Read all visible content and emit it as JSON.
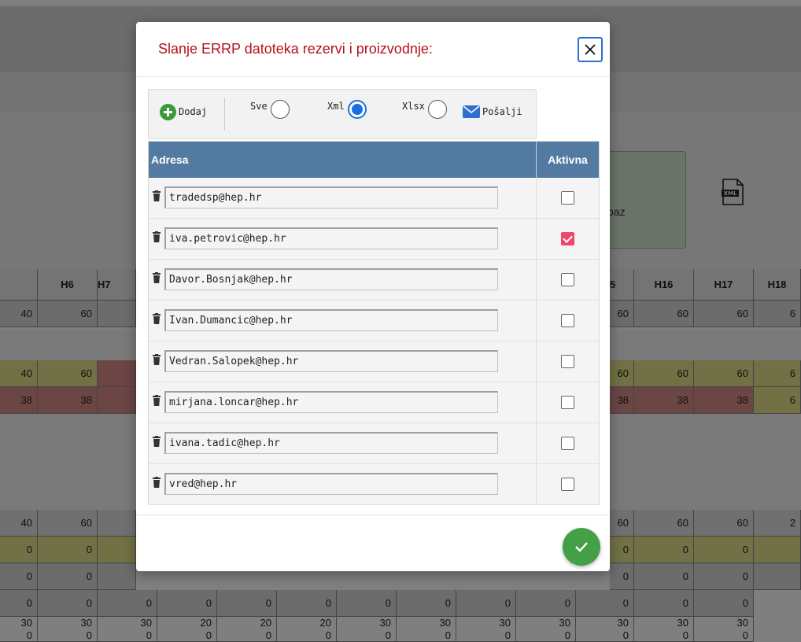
{
  "background": {
    "tile_label": "baz",
    "header_left": [
      "",
      "H6",
      "H7"
    ],
    "header_right": [
      "5",
      "H16",
      "H17",
      "H18"
    ],
    "rows": [
      {
        "color": "#d9d9d9",
        "left": [
          "40",
          "60"
        ],
        "right": [
          "60",
          "60",
          "60",
          "6"
        ]
      },
      {
        "color": "#e3e38a",
        "left": [
          "40",
          "60"
        ],
        "right": [
          "60",
          "60",
          "60",
          "6"
        ],
        "h7": "#d98b8b"
      },
      {
        "color": "#d98b8b",
        "left": [
          "38",
          "38"
        ],
        "right": [
          "38",
          "38",
          "38",
          "6"
        ],
        "right_last_color": "#e3e38a"
      },
      {
        "color": "#e0e0e0",
        "left": [
          "40",
          "60"
        ],
        "right": [
          "60",
          "60",
          "60",
          "2"
        ]
      },
      {
        "color": "#e3e38a",
        "left": [
          "0",
          "0"
        ],
        "right": [
          "0",
          "0",
          "0",
          ""
        ]
      },
      {
        "color": "#d9d9d9",
        "left": [
          "0",
          "0"
        ],
        "right": [
          "0",
          "0",
          "0",
          ""
        ]
      }
    ],
    "bottom_row_0": [
      "0",
      "0",
      "0",
      "0",
      "0",
      "0",
      "0",
      "0",
      "0",
      "0",
      "0",
      "0",
      "0"
    ],
    "bottom_row_30": [
      "30",
      "30",
      "30",
      "20",
      "20",
      "20",
      "30",
      "30",
      "30",
      "30",
      "30",
      "30",
      "30"
    ],
    "bottom_row_0b": [
      "0",
      "0",
      "0",
      "0",
      "0",
      "0",
      "0",
      "0",
      "0",
      "0",
      "0",
      "0",
      "0"
    ]
  },
  "modal": {
    "title": "Slanje ERRP datoteka rezervi i proizvodnje:",
    "toolbar": {
      "add_label": "Dodaj",
      "radios": [
        {
          "label": "Sve",
          "checked": false
        },
        {
          "label": "Xml",
          "checked": true
        },
        {
          "label": "Xlsx",
          "checked": false
        }
      ],
      "send_label": "Pošalji"
    },
    "table": {
      "col_address": "Adresa",
      "col_active": "Aktivna",
      "rows": [
        {
          "email": "tradedsp@hep.hr",
          "active": false
        },
        {
          "email": "iva.petrovic@hep.hr",
          "active": true
        },
        {
          "email": "Davor.Bosnjak@hep.hr",
          "active": false
        },
        {
          "email": "Ivan.Dumancic@hep.hr",
          "active": false
        },
        {
          "email": "Vedran.Salopek@hep.hr",
          "active": false
        },
        {
          "email": "mirjana.loncar@hep.hr",
          "active": false
        },
        {
          "email": "ivana.tadic@hep.hr",
          "active": false
        },
        {
          "email": "vred@hep.hr",
          "active": false
        }
      ]
    }
  },
  "icons": {
    "close": "close-icon",
    "add": "plus-circle-icon",
    "send": "envelope-icon",
    "trash": "trash-icon",
    "ok": "check-icon",
    "xml_file": "xml-file-icon"
  },
  "colors": {
    "title": "#b5121b",
    "table_header": "#537aa1",
    "checkbox_on": "#f0466b",
    "ok_button": "#43a047",
    "radio_on": "#1a6fe0"
  }
}
